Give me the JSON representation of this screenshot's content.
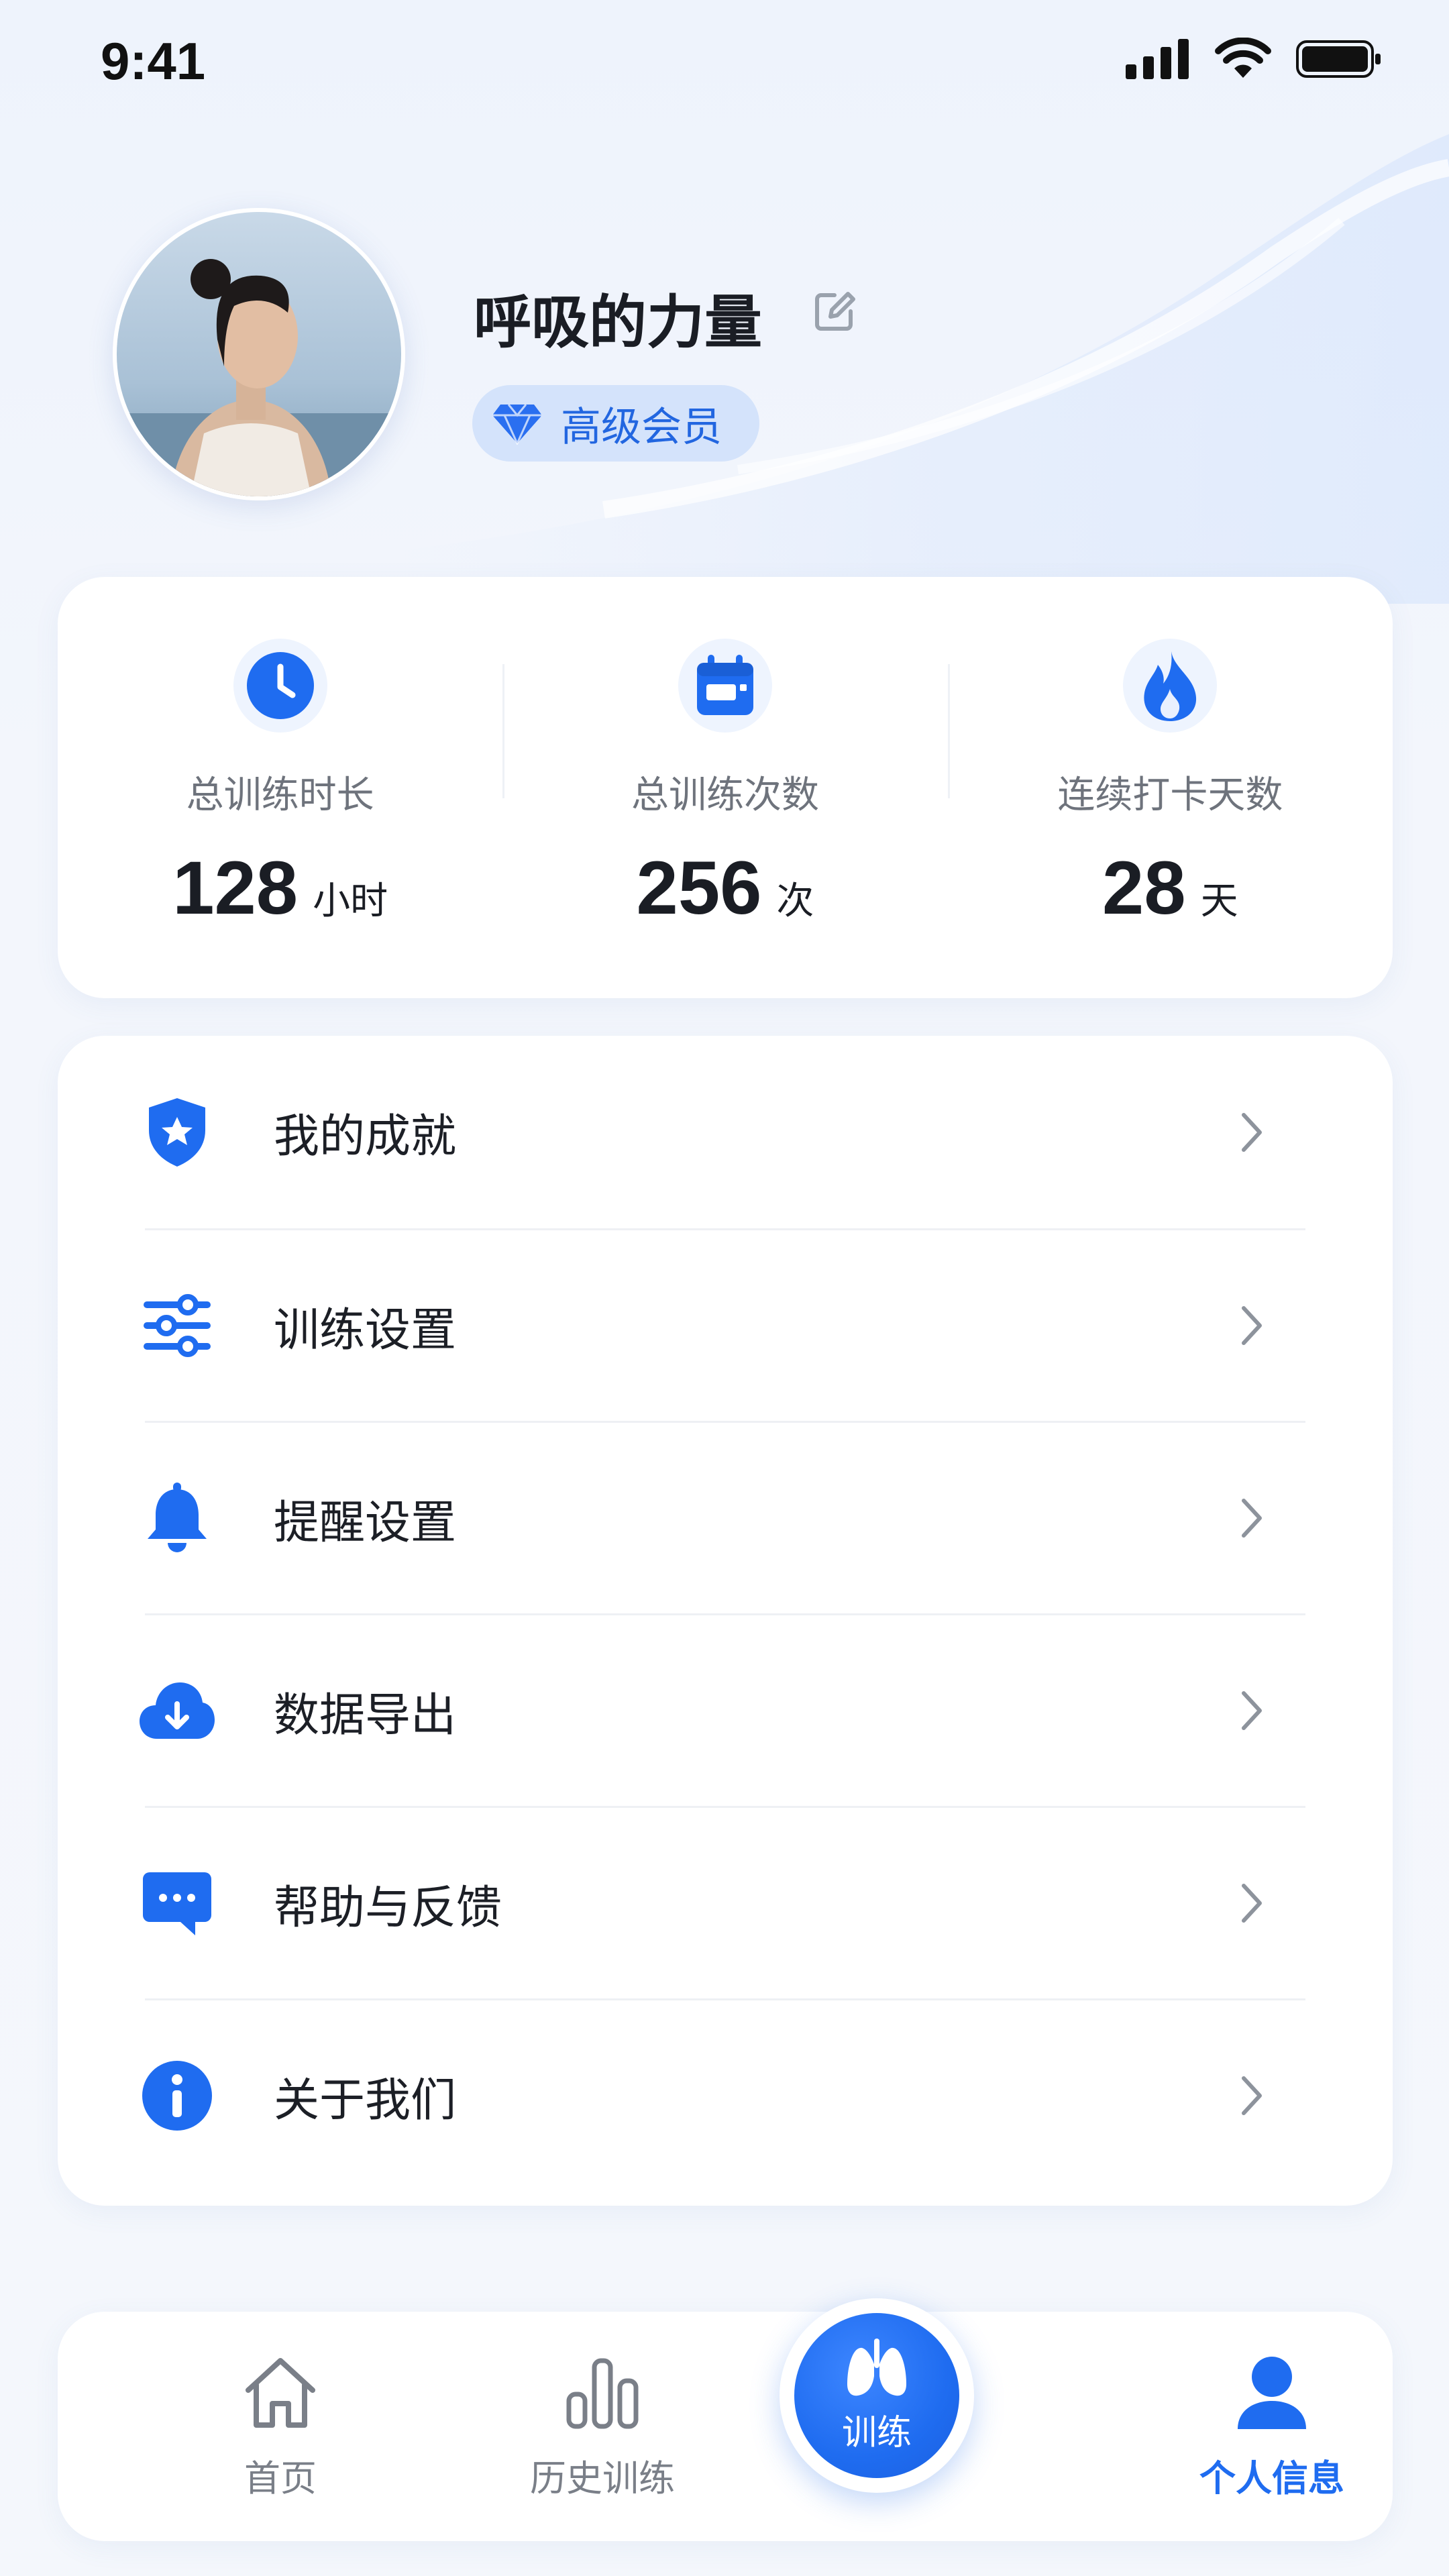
{
  "status_bar": {
    "time": "9:41"
  },
  "profile": {
    "username": "呼吸的力量",
    "badge": "高级会员"
  },
  "stats": [
    {
      "icon": "clock-icon",
      "label": "总训练时长",
      "value": "128",
      "unit": "小时"
    },
    {
      "icon": "calendar-icon",
      "label": "总训练次数",
      "value": "256",
      "unit": "次"
    },
    {
      "icon": "flame-icon",
      "label": "连续打卡天数",
      "value": "28",
      "unit": "天"
    }
  ],
  "menu": [
    {
      "icon": "shield-star-icon",
      "label": "我的成就"
    },
    {
      "icon": "sliders-icon",
      "label": "训练设置"
    },
    {
      "icon": "bell-icon",
      "label": "提醒设置"
    },
    {
      "icon": "cloud-download-icon",
      "label": "数据导出"
    },
    {
      "icon": "chat-icon",
      "label": "帮助与反馈"
    },
    {
      "icon": "info-icon",
      "label": "关于我们"
    }
  ],
  "tabs": {
    "home": "首页",
    "history": "历史训练",
    "train": "训练",
    "profile": "个人信息",
    "active": "profile"
  },
  "colors": {
    "accent": "#1f6cf0",
    "badge_bg": "#d4e3fb",
    "text_primary": "#1a1d24",
    "text_secondary": "#6e737c"
  }
}
